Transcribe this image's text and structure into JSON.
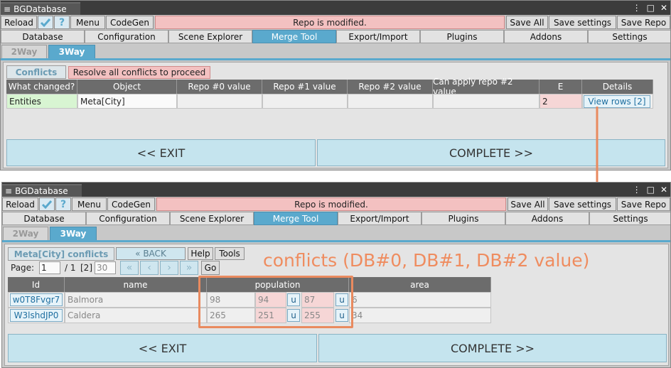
{
  "window": {
    "title": "BGDatabase"
  },
  "toolbar": {
    "reload": "Reload",
    "check_icon": "check-icon",
    "help_icon": "question-icon",
    "menu": "Menu",
    "codegen": "CodeGen",
    "status": "Repo is modified.",
    "save_all": "Save All",
    "save_settings": "Save settings",
    "save_repo": "Save Repo"
  },
  "main_tabs": [
    "Database",
    "Configuration",
    "Scene Explorer",
    "Merge Tool",
    "Export/Import",
    "Plugins",
    "Addons",
    "Settings"
  ],
  "active_main_tab": "Merge Tool",
  "sub_tabs": [
    "2Way",
    "3Way"
  ],
  "active_sub_tab": "3Way",
  "top": {
    "conflicts_tab": "Conflicts",
    "warning": "Resolve all conflicts to proceed",
    "columns": [
      "What changed?",
      "Object",
      "Repo #0 value",
      "Repo #1 value",
      "Repo #2 value",
      "Can apply repo #2 value",
      "E",
      "Details"
    ],
    "row": {
      "what_changed": "Entities",
      "object": "Meta[City]",
      "e": "2",
      "details": "View rows [2]"
    },
    "exit": "<< EXIT",
    "complete": "COMPLETE >>"
  },
  "bottom": {
    "conflicts_title": "Meta[City] conflicts",
    "back": "BACK",
    "help": "Help",
    "tools": "Tools",
    "page_label": "Page:",
    "page_value": "1",
    "page_total": "/ 1",
    "page_size_label": "[2]",
    "page_size_value": "30",
    "go": "Go",
    "columns": {
      "id": "Id",
      "name": "name",
      "population": "population",
      "area": "area"
    },
    "rows": [
      {
        "id": "w0T8Fvgr7",
        "name": "Balmora",
        "pop0": "98",
        "pop1": "94",
        "pop2": "87",
        "u": "u",
        "area": "6"
      },
      {
        "id": "W3lshdJP0",
        "name": "Caldera",
        "pop0": "265",
        "pop1": "251",
        "pop2": "255",
        "u": "u",
        "area": "34"
      }
    ],
    "exit": "<< EXIT",
    "complete": "COMPLETE >>"
  },
  "annotation": {
    "text": "conflicts (DB#0, DB#1, DB#2 value)"
  },
  "colors": {
    "accent": "#5aa9cd",
    "status_bg": "#f3c1c1",
    "annotation": "#ef8c5f",
    "changed": "#d8f5d2",
    "conflict": "#f6d6d6"
  }
}
